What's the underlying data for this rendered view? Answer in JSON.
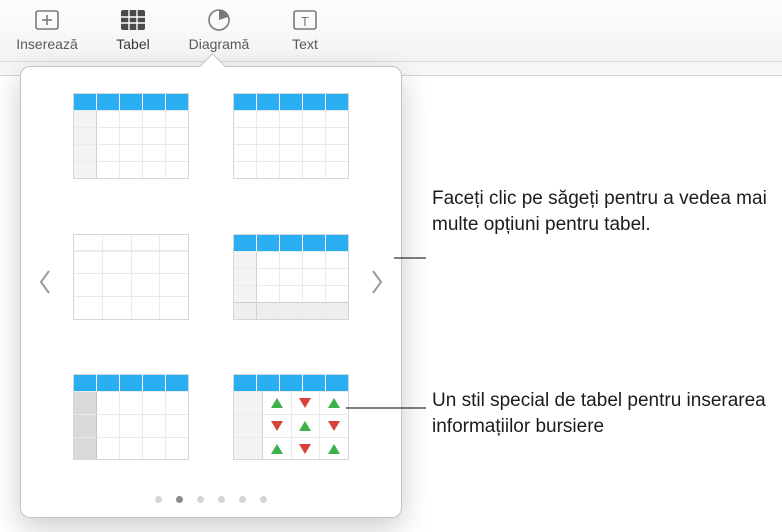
{
  "toolbar": {
    "insert_label": "Inserează",
    "table_label": "Tabel",
    "chart_label": "Diagramă",
    "text_label": "Text"
  },
  "popover": {
    "page_count": 6,
    "active_page_index": 1
  },
  "annotations": {
    "arrows_hint": "Faceți clic pe săgeți pentru a vedea mai multe opțiuni pentru tabel.",
    "stock_hint": "Un stil special de tabel pentru inserarea informațiilor bursiere"
  }
}
